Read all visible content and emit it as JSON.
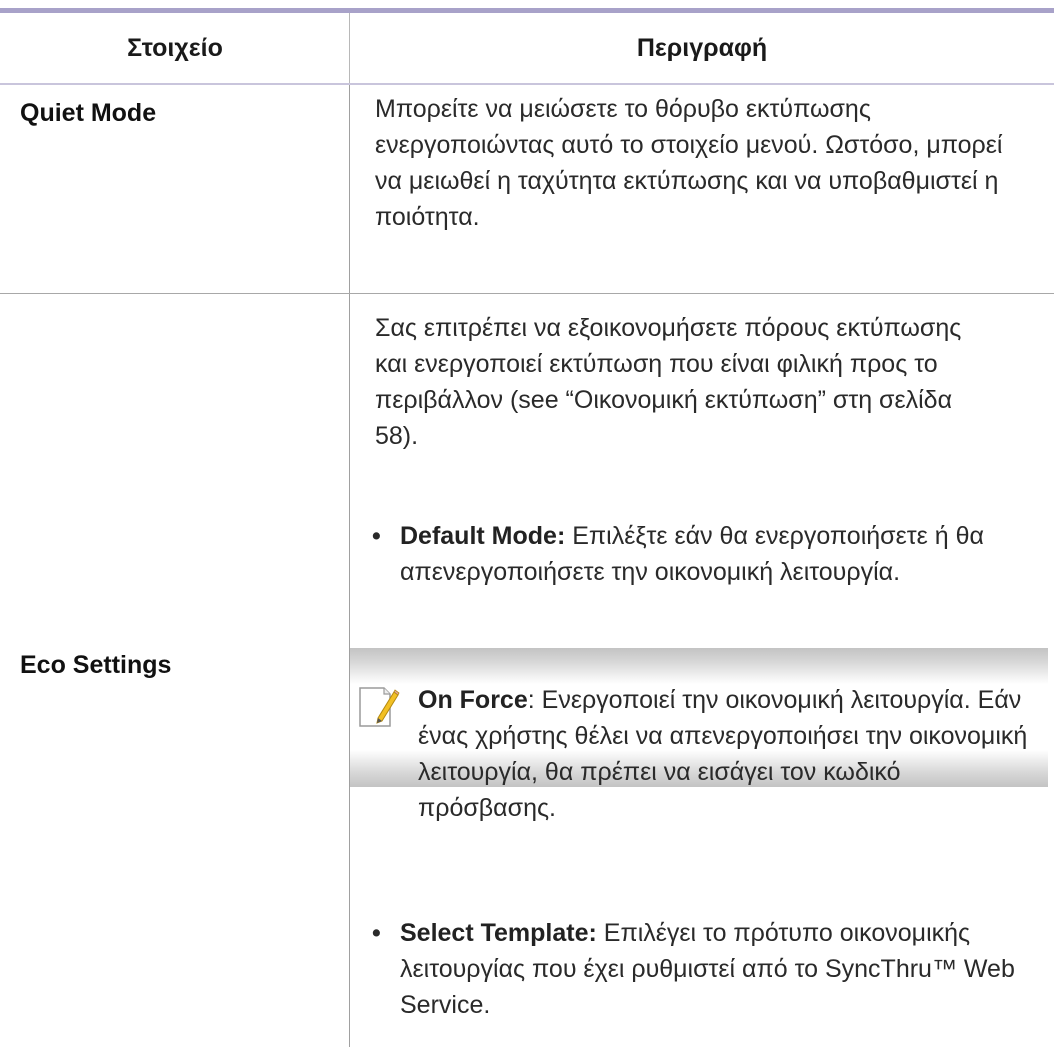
{
  "table": {
    "headers": {
      "item": "Στοιχείο",
      "description": "Περιγραφή"
    },
    "rows": [
      {
        "item": "Quiet Mode",
        "description": "Μπορείτε να μειώσετε το θόρυβο εκτύπωσης ενεργοποιώντας αυτό το στοιχείο μενού. Ωστόσο, μπορεί να μειωθεί η ταχύτητα εκτύπωσης και να υποβαθμιστεί η ποιότητα."
      },
      {
        "item": "Eco Settings",
        "description": "Σας επιτρέπει να εξοικονομήσετε πόρους εκτύπωσης και ενεργοποιεί εκτύπωση που είναι φιλική προς το περιβάλλον (see “Οικονομική εκτύπωση” στη σελίδα 58).",
        "bullets": [
          {
            "term": "Default Mode:",
            "text": " Επιλέξτε εάν θα ενεργοποιήσετε ή θα απενεργοποιήσετε την οικονομική λειτουργία."
          },
          {
            "term": "Select Template:",
            "text": " Επιλέγει το πρότυπο οικονομικής λειτουργίας που έχει ρυθμιστεί από το SyncThru™ Web Service."
          }
        ],
        "note": {
          "icon": "note-pencil-icon",
          "term": "On Force",
          "text": ": Ενεργοποιεί την οικονομική λειτουργία. Εάν ένας χρήστης θέλει να απενεργοποιήσει την οικονομική λειτουργία, θα πρέπει να εισάγει τον κωδικό πρόσβασης."
        }
      }
    ]
  }
}
